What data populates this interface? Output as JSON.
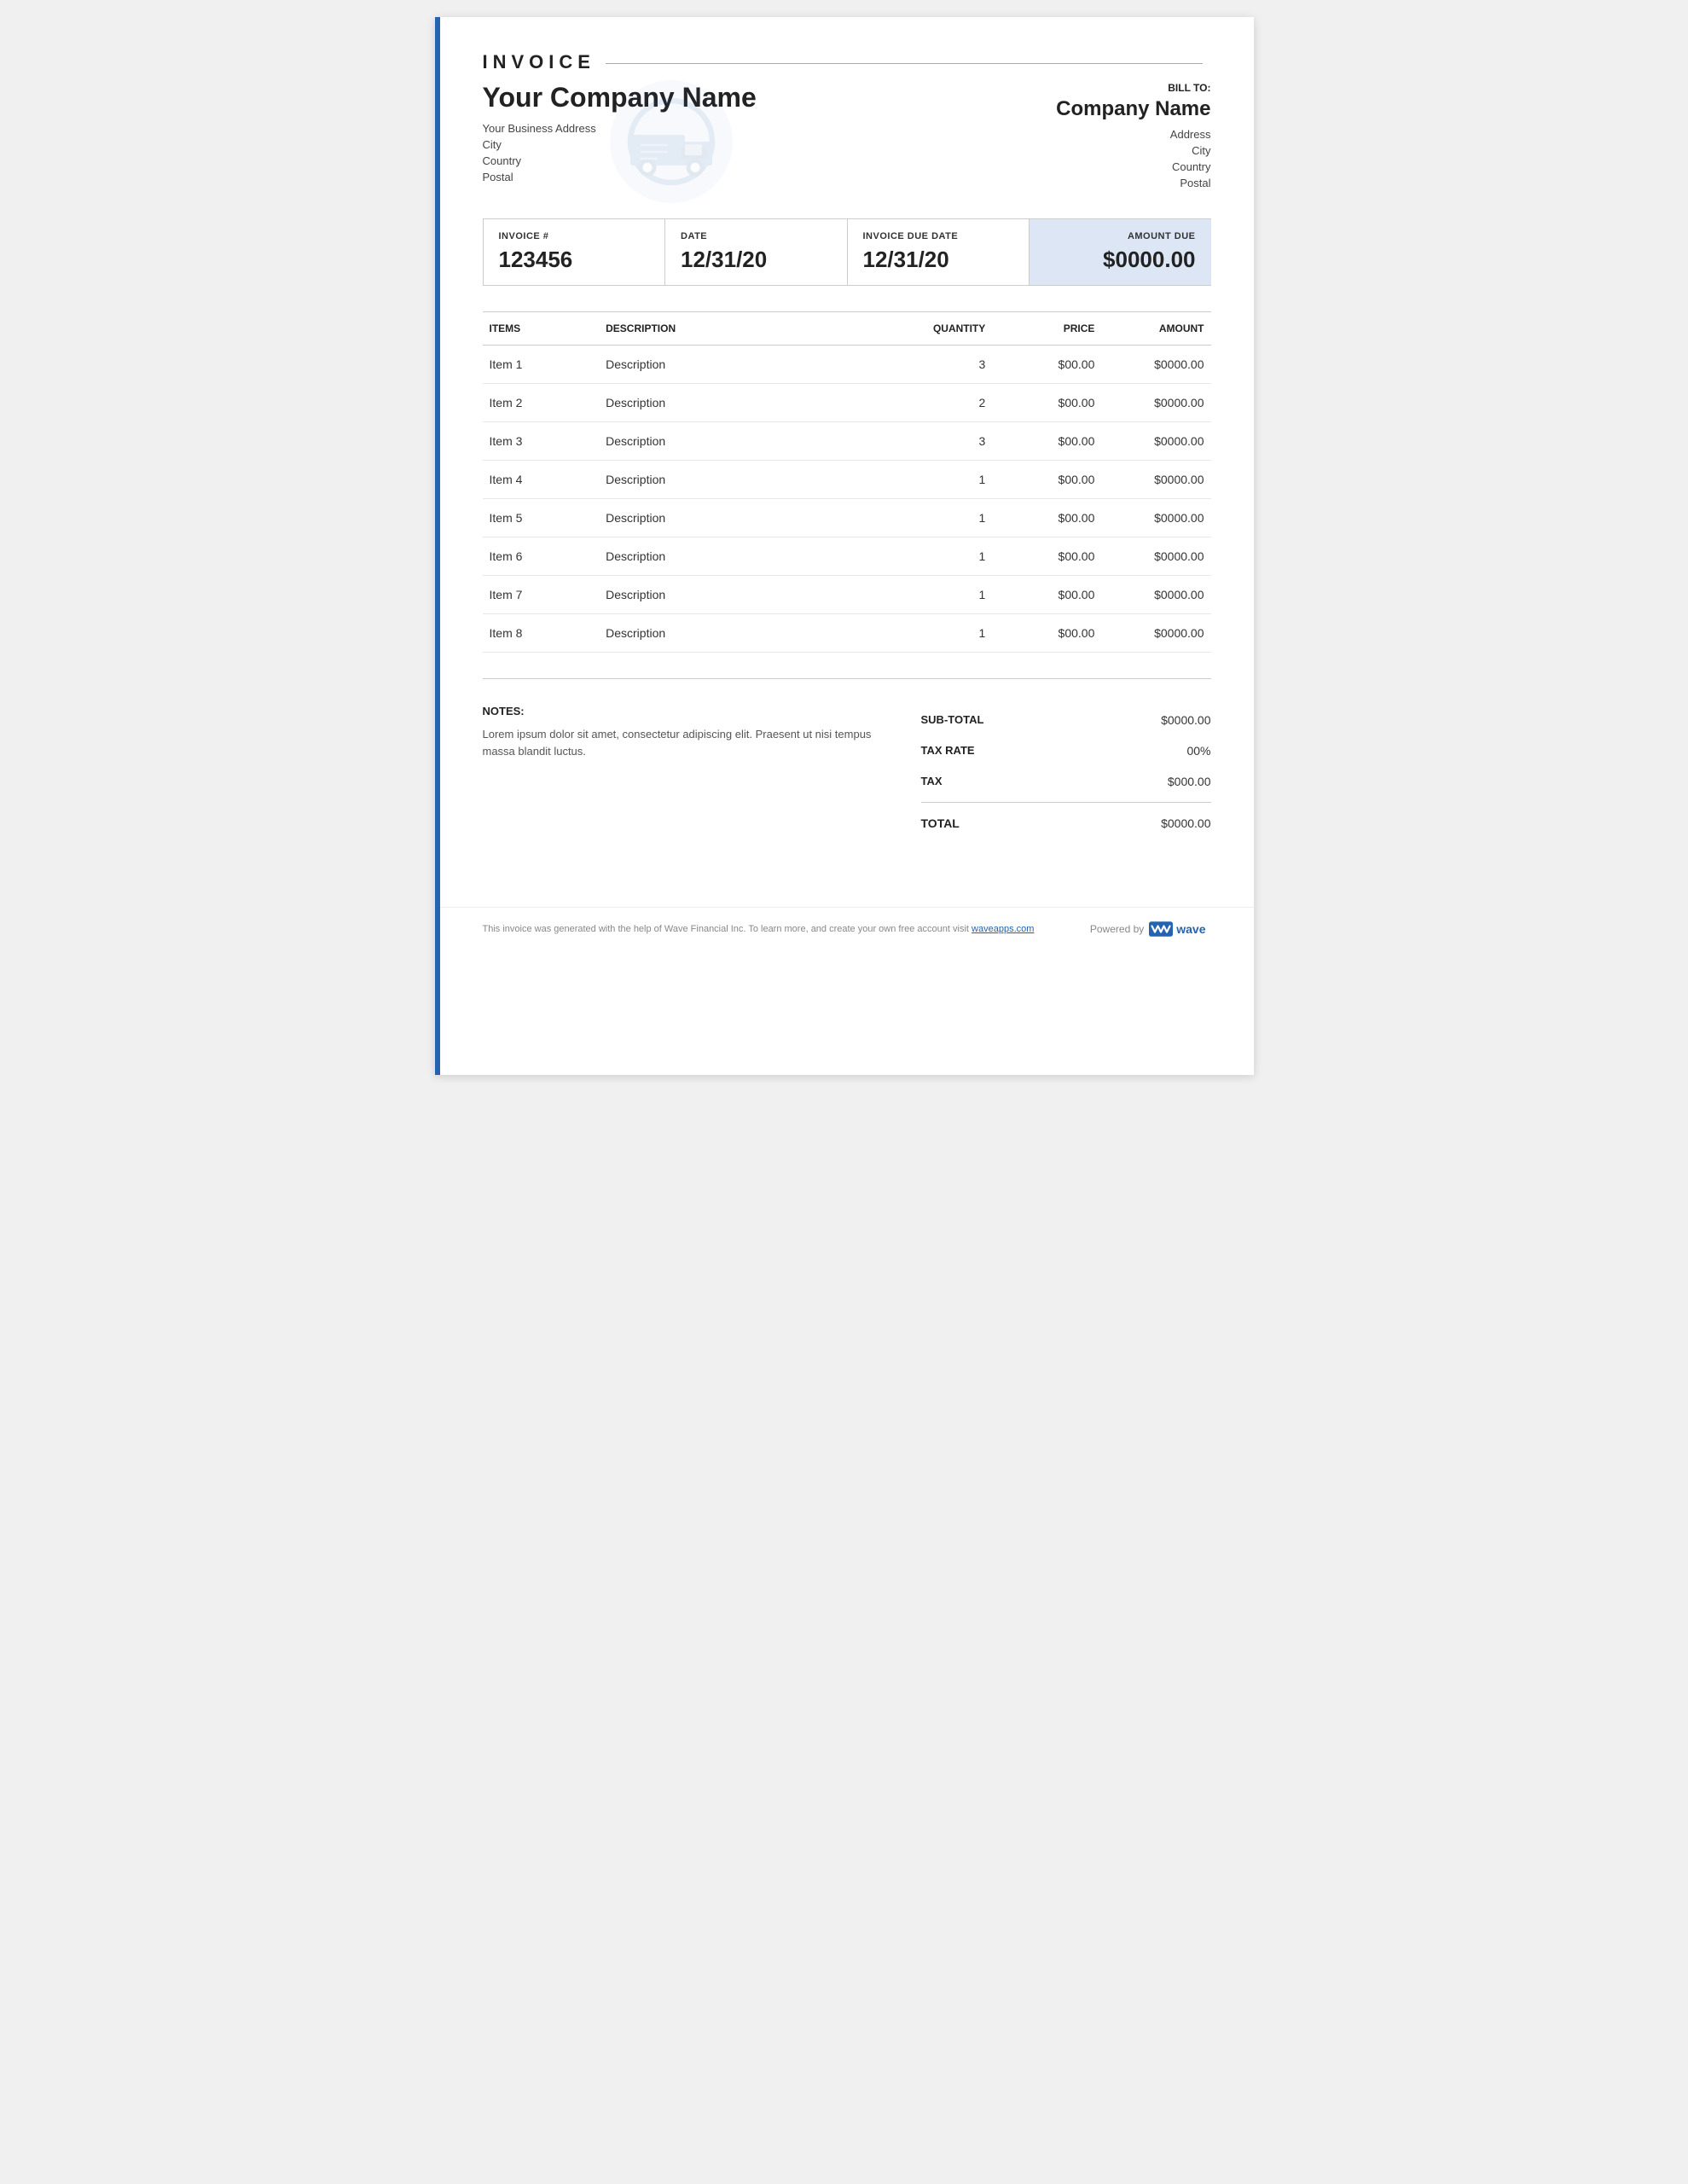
{
  "invoice": {
    "title": "INVOICE",
    "company": {
      "name": "Your Company Name",
      "address": "Your Business Address",
      "city": "City",
      "country": "Country",
      "postal": "Postal"
    },
    "bill_to": {
      "label": "BILL TO:",
      "name": "Company Name",
      "address": "Address",
      "city": "City",
      "country": "Country",
      "postal": "Postal"
    },
    "info": {
      "invoice_num_label": "INVOICE #",
      "invoice_num": "123456",
      "date_label": "DATE",
      "date": "12/31/20",
      "due_date_label": "INVOICE DUE DATE",
      "due_date": "12/31/20",
      "amount_due_label": "AMOUNT DUE",
      "amount_due": "$0000.00"
    },
    "table": {
      "col_items": "ITEMS",
      "col_description": "DESCRIPTION",
      "col_quantity": "QUANTITY",
      "col_price": "PRICE",
      "col_amount": "AMOUNT",
      "rows": [
        {
          "item": "Item 1",
          "description": "Description",
          "quantity": "3",
          "price": "$00.00",
          "amount": "$0000.00"
        },
        {
          "item": "Item 2",
          "description": "Description",
          "quantity": "2",
          "price": "$00.00",
          "amount": "$0000.00"
        },
        {
          "item": "Item 3",
          "description": "Description",
          "quantity": "3",
          "price": "$00.00",
          "amount": "$0000.00"
        },
        {
          "item": "Item 4",
          "description": "Description",
          "quantity": "1",
          "price": "$00.00",
          "amount": "$0000.00"
        },
        {
          "item": "Item 5",
          "description": "Description",
          "quantity": "1",
          "price": "$00.00",
          "amount": "$0000.00"
        },
        {
          "item": "Item 6",
          "description": "Description",
          "quantity": "1",
          "price": "$00.00",
          "amount": "$0000.00"
        },
        {
          "item": "Item 7",
          "description": "Description",
          "quantity": "1",
          "price": "$00.00",
          "amount": "$0000.00"
        },
        {
          "item": "Item 8",
          "description": "Description",
          "quantity": "1",
          "price": "$00.00",
          "amount": "$0000.00"
        }
      ]
    },
    "notes": {
      "label": "NOTES:",
      "text": "Lorem ipsum dolor sit amet, consectetur adipiscing elit. Praesent ut nisi tempus massa blandit luctus."
    },
    "totals": {
      "subtotal_label": "SUB-TOTAL",
      "subtotal_value": "$0000.00",
      "tax_rate_label": "TAX RATE",
      "tax_rate_value": "00%",
      "tax_label": "TAX",
      "tax_value": "$000.00",
      "total_label": "TOTAL",
      "total_value": "$0000.00"
    },
    "footer": {
      "disclaimer": "This invoice was generated with the help of Wave Financial Inc. To learn more, and create your own free account visit",
      "link_text": "waveapps.com",
      "powered_by": "Powered by",
      "wave_label": "wave"
    }
  }
}
